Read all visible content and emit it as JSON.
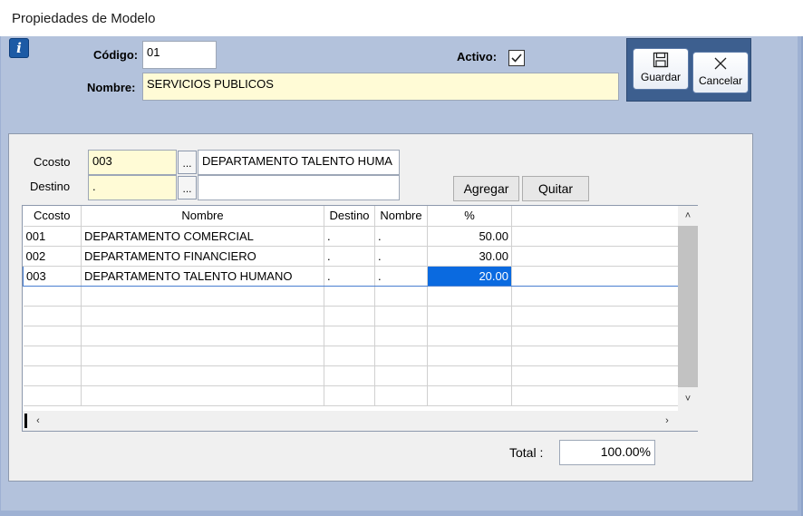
{
  "window": {
    "title": "Propiedades de Modelo"
  },
  "header": {
    "codigo_label": "Código:",
    "codigo_value": "01",
    "activo_label": "Activo:",
    "activo_checked": true,
    "nombre_label": "Nombre:",
    "nombre_value": "SERVICIOS PUBLICOS"
  },
  "toolbar": {
    "save_label": "Guardar",
    "cancel_label": "Cancelar"
  },
  "form": {
    "ccosto_label": "Ccosto",
    "ccosto_code": "003",
    "ccosto_desc": "DEPARTAMENTO TALENTO HUMA",
    "destino_label": "Destino",
    "destino_code": ".",
    "destino_desc": "",
    "browse_label": "...",
    "add_label": "Agregar",
    "remove_label": "Quitar"
  },
  "grid": {
    "columns": [
      "Ccosto",
      "Nombre",
      "Destino",
      "Nombre",
      "%"
    ],
    "rows": [
      [
        "001",
        "DEPARTAMENTO COMERCIAL",
        ".",
        ".",
        "50.00"
      ],
      [
        "002",
        "DEPARTAMENTO FINANCIERO",
        ".",
        ".",
        "30.00"
      ],
      [
        "003",
        "DEPARTAMENTO TALENTO HUMANO",
        ".",
        ".",
        "20.00"
      ]
    ],
    "selected_row": 2
  },
  "total": {
    "label": "Total :",
    "value": "100.00%"
  }
}
